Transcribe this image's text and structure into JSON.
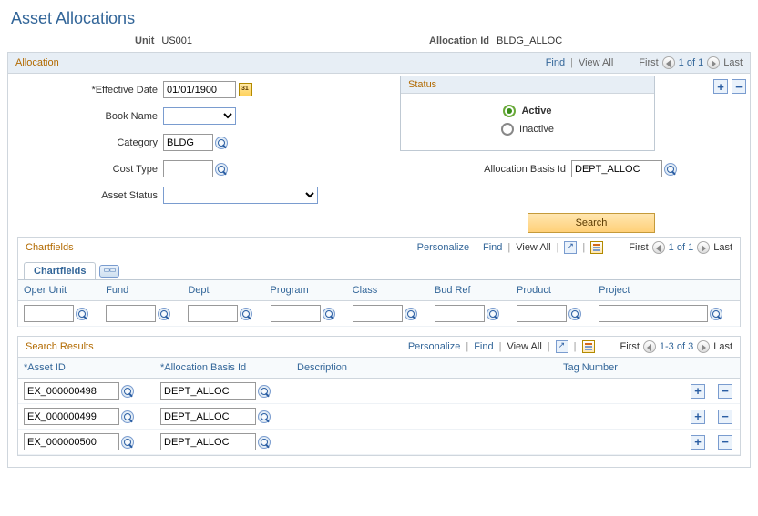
{
  "page": {
    "title": "Asset Allocations"
  },
  "header": {
    "unit_label": "Unit",
    "unit_value": "US001",
    "alloc_label": "Allocation Id",
    "alloc_value": "BLDG_ALLOC"
  },
  "alloc_section": {
    "title": "Allocation",
    "toolbar": {
      "find": "Find",
      "view_all": "View All",
      "first": "First",
      "range": "1 of 1",
      "last": "Last"
    },
    "fields": {
      "effdt_label": "Effective Date",
      "effdt_value": "01/01/1900",
      "book_label": "Book Name",
      "category_label": "Category",
      "category_value": "BLDG",
      "costtype_label": "Cost Type",
      "costtype_value": "",
      "assetstatus_label": "Asset Status",
      "allocbasis_label": "Allocation Basis Id",
      "allocbasis_value": "DEPT_ALLOC"
    },
    "status": {
      "title": "Status",
      "active": "Active",
      "inactive": "Inactive",
      "selected": "active"
    },
    "search_btn": "Search"
  },
  "chartfields": {
    "title": "Chartfields",
    "toolbar": {
      "personalize": "Personalize",
      "find": "Find",
      "view_all": "View All",
      "first": "First",
      "range": "1 of 1",
      "last": "Last"
    },
    "tab_label": "Chartfields",
    "columns": [
      "Oper Unit",
      "Fund",
      "Dept",
      "Program",
      "Class",
      "Bud Ref",
      "Product",
      "Project"
    ]
  },
  "results": {
    "title": "Search Results",
    "toolbar": {
      "personalize": "Personalize",
      "find": "Find",
      "view_all": "View All",
      "first": "First",
      "range": "1-3 of 3",
      "last": "Last"
    },
    "columns": {
      "asset_id": "Asset ID",
      "alloc_basis": "Allocation Basis Id",
      "description": "Description",
      "tag": "Tag Number"
    },
    "rows": [
      {
        "asset_id": "EX_000000498",
        "alloc_basis": "DEPT_ALLOC",
        "description": "",
        "tag": ""
      },
      {
        "asset_id": "EX_000000499",
        "alloc_basis": "DEPT_ALLOC",
        "description": "",
        "tag": ""
      },
      {
        "asset_id": "EX_000000500",
        "alloc_basis": "DEPT_ALLOC",
        "description": "",
        "tag": ""
      }
    ]
  }
}
